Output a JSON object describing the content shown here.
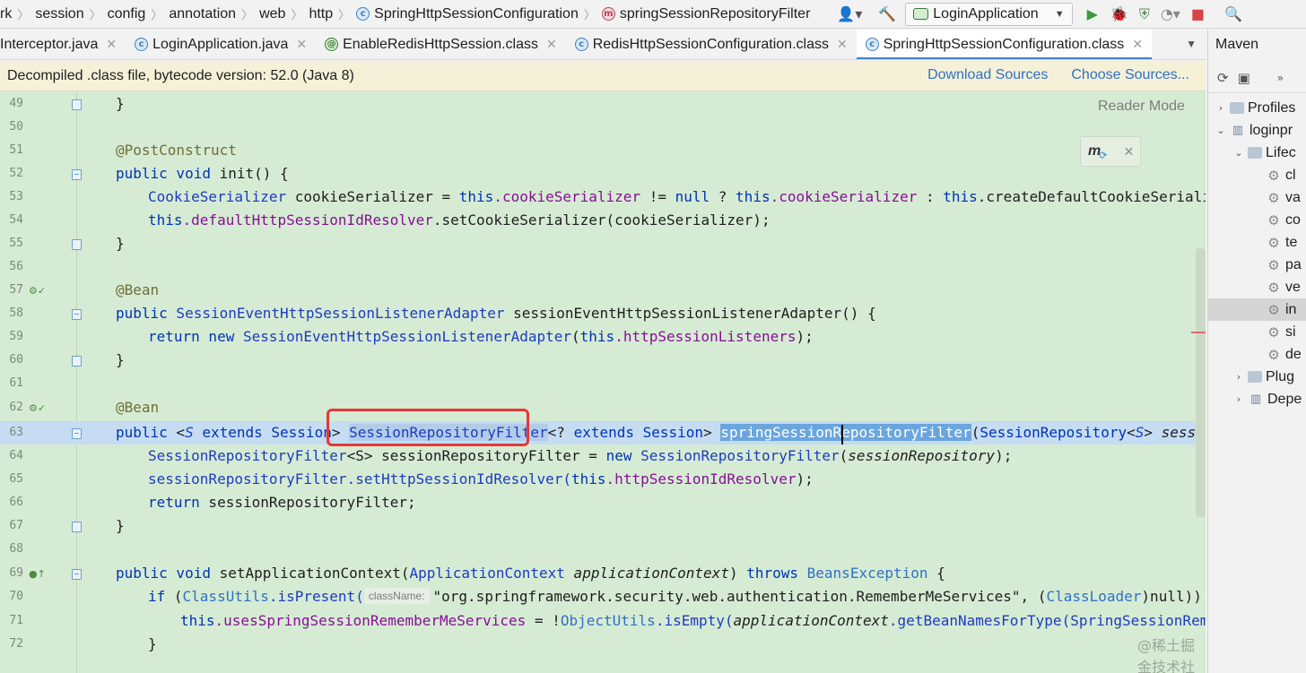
{
  "navbar": {
    "breadcrumbs": [
      "rk",
      "session",
      "config",
      "annotation",
      "web",
      "http",
      "SpringHttpSessionConfiguration",
      "springSessionRepositoryFilter"
    ],
    "run_config": "LoginApplication"
  },
  "tabs": [
    {
      "label": "Interceptor.java",
      "icon": "class-icon"
    },
    {
      "label": "LoginApplication.java",
      "icon": "class-icon"
    },
    {
      "label": "EnableRedisHttpSession.class",
      "icon": "annotation-icon"
    },
    {
      "label": "RedisHttpSessionConfiguration.class",
      "icon": "class-icon"
    },
    {
      "label": "SpringHttpSessionConfiguration.class",
      "icon": "class-icon",
      "active": true
    }
  ],
  "notice": {
    "text": "Decompiled .class file, bytecode version: 52.0 (Java 8)",
    "download_sources": "Download Sources",
    "choose_sources": "Choose Sources..."
  },
  "editor": {
    "reader_mode": "Reader Mode",
    "maven_popup_letter": "m",
    "param_hint": "className:",
    "line_numbers": [
      "49",
      "50",
      "51",
      "52",
      "53",
      "54",
      "55",
      "56",
      "57",
      "58",
      "59",
      "60",
      "61",
      "62",
      "63",
      "64",
      "65",
      "66",
      "67",
      "68",
      "69",
      "70",
      "71",
      "72"
    ],
    "current_line": "63",
    "watermark": "@稀土掘金技术社区"
  },
  "code": {
    "l49": "}",
    "l51_ann": "@PostConstruct",
    "l52": {
      "kw": "public void",
      "rest": " init() {"
    },
    "l53": {
      "type": "CookieSerializer",
      "var": " cookieSerializer = ",
      "this1": "this",
      "f1": ".cookieSerializer",
      "mid": " != ",
      "null": "null",
      "q": " ? ",
      "this2": "this",
      "f2": ".cookieSerializer",
      "colon": " : ",
      "this3": "this",
      "end": ".createDefaultCookieSerializer();"
    },
    "l54": {
      "this": "this",
      "f": ".defaultHttpSessionIdResolver",
      "end": ".setCookieSerializer(cookieSerializer);"
    },
    "l55": "}",
    "l57_ann": "@Bean",
    "l58": {
      "kw": "public",
      "type": " SessionEventHttpSessionListenerAdapter",
      "rest": " sessionEventHttpSessionListenerAdapter() {"
    },
    "l59": {
      "kw": "return new",
      "type": " SessionEventHttpSessionListenerAdapter",
      "p": "(",
      "this": "this",
      "f": ".httpSessionListeners",
      "end": ");"
    },
    "l60": "}",
    "l62_ann": "@Bean",
    "l63": {
      "kw1": "public",
      "lt": " <",
      "S": "S",
      "ext1": " extends",
      "sess1": " Session",
      "gt": "> ",
      "filter": "SessionRepositoryFilter",
      "lt2": "<",
      "q": "?",
      "ext2": " extends",
      "sess2": " Session",
      "gt2": "> ",
      "method": "springSessionRepositoryFilter",
      "p": "(",
      "repo": "SessionRepository",
      "lt3": "<",
      "S2": "S",
      "gt3": "> ",
      "param": "sessionReposit"
    },
    "l64": {
      "type": "SessionRepositoryFilter",
      "gen": "<S>",
      "var": " sessionRepositoryFilter = ",
      "kw": "new",
      "type2": " SessionRepositoryFilter",
      "p": "(",
      "param": "sessionRepository",
      "end": ");"
    },
    "l65": {
      "pre": "sessionRepositoryFilter.setHttpSessionIdResolver(",
      "this": "this",
      "f": ".httpSessionIdResolver",
      "end": ");"
    },
    "l66": {
      "kw": "return",
      "rest": " sessionRepositoryFilter;"
    },
    "l67": "}",
    "l69": {
      "kw": "public void",
      "rest": " setApplicationContext(",
      "type": "ApplicationContext",
      "param": " applicationContext",
      "close": ") ",
      "throws": "throws",
      "exc": " BeansException",
      "end": " {"
    },
    "l70": {
      "kw": "if",
      "p": " (",
      "cls": "ClassUtils",
      "m": ".isPresent(",
      "str": "\"org.springframework.security.web.authentication.RememberMeServices\"",
      "mid": ", (",
      "cls2": "ClassLoader",
      "end": ")null)) {"
    },
    "l71": {
      "this": "this",
      "f": ".usesSpringSessionRememberMeServices",
      "mid": " = !",
      "cls": "ObjectUtils",
      "m": ".isEmpty(",
      "param": "applicationContext",
      "end": ".getBeanNamesForType(",
      "type": "SpringSessionRememberMeS"
    },
    "l72": "}"
  },
  "maven": {
    "title": "Maven",
    "tree": [
      {
        "label": "Profiles",
        "indent": 0,
        "twisty": "›",
        "icon": "folder"
      },
      {
        "label": "loginpr",
        "indent": 0,
        "twisty": "⌄",
        "icon": "bars"
      },
      {
        "label": "Lifec",
        "indent": 1,
        "twisty": "⌄",
        "icon": "folder"
      },
      {
        "label": "cl",
        "indent": 2,
        "twisty": "",
        "icon": "gear"
      },
      {
        "label": "va",
        "indent": 2,
        "twisty": "",
        "icon": "gear"
      },
      {
        "label": "co",
        "indent": 2,
        "twisty": "",
        "icon": "gear"
      },
      {
        "label": "te",
        "indent": 2,
        "twisty": "",
        "icon": "gear"
      },
      {
        "label": "pa",
        "indent": 2,
        "twisty": "",
        "icon": "gear"
      },
      {
        "label": "ve",
        "indent": 2,
        "twisty": "",
        "icon": "gear"
      },
      {
        "label": "in",
        "indent": 2,
        "twisty": "",
        "icon": "gear",
        "selected": true
      },
      {
        "label": "si",
        "indent": 2,
        "twisty": "",
        "icon": "gear"
      },
      {
        "label": "de",
        "indent": 2,
        "twisty": "",
        "icon": "gear"
      },
      {
        "label": "Plug",
        "indent": 1,
        "twisty": "›",
        "icon": "folder"
      },
      {
        "label": "Depe",
        "indent": 1,
        "twisty": "›",
        "icon": "bars"
      }
    ]
  }
}
